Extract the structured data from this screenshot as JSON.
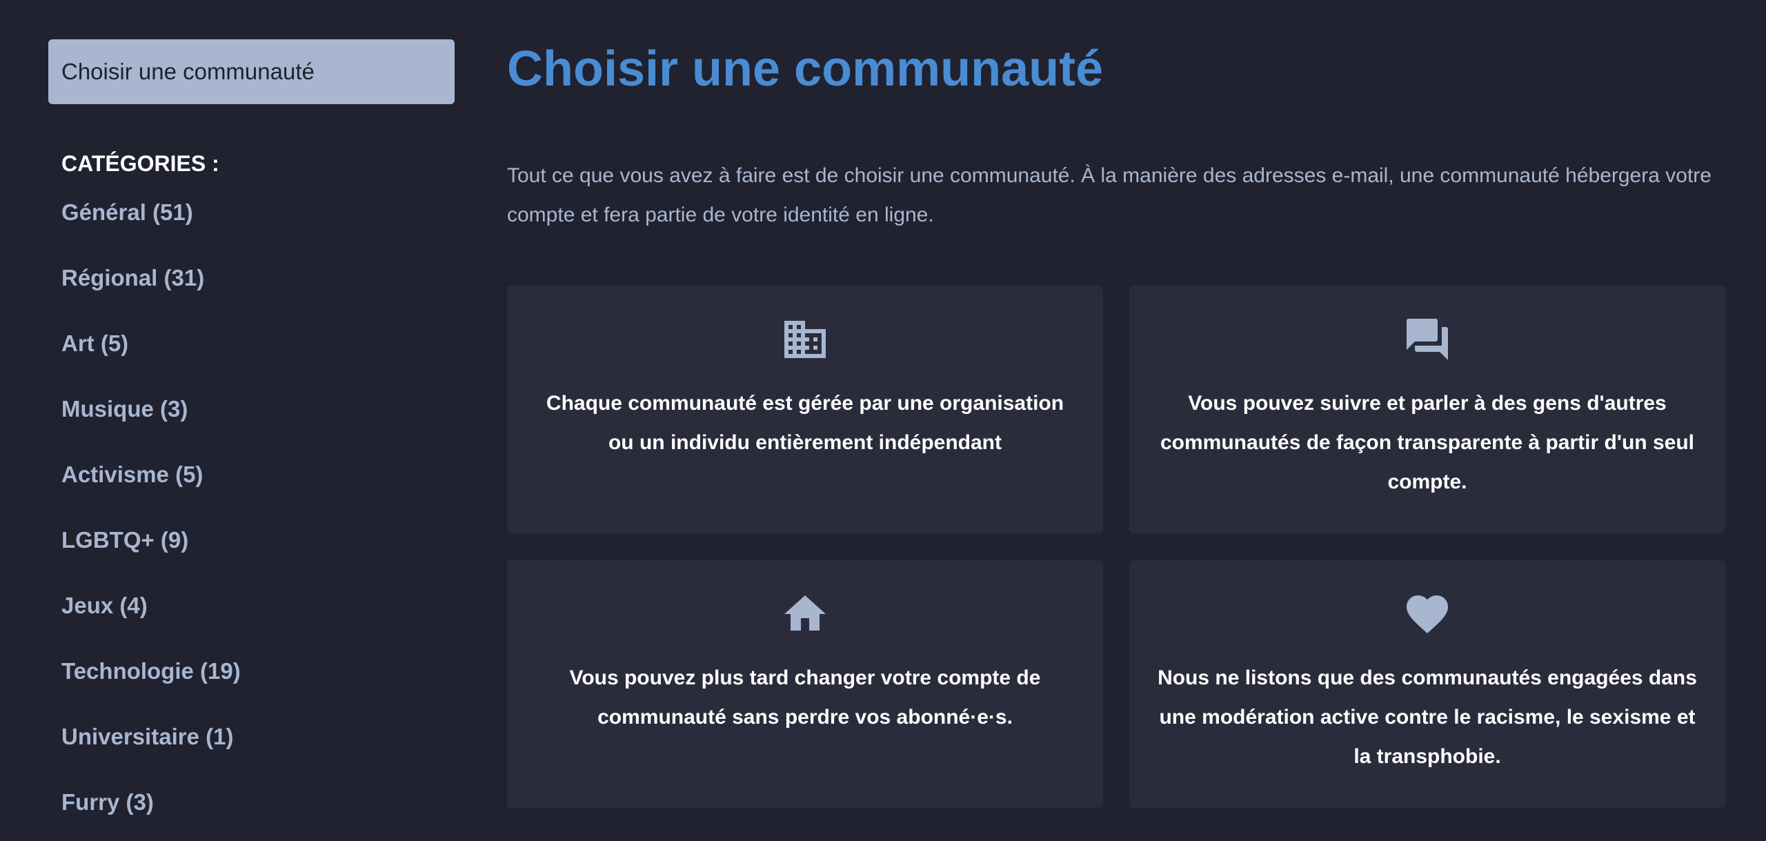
{
  "sidebar": {
    "active_label": "Choisir une communauté",
    "categories_heading": "CATÉGORIES :",
    "categories": [
      {
        "label": "Général (51)"
      },
      {
        "label": "Régional (31)"
      },
      {
        "label": "Art (5)"
      },
      {
        "label": "Musique (3)"
      },
      {
        "label": "Activisme (5)"
      },
      {
        "label": "LGBTQ+ (9)"
      },
      {
        "label": "Jeux (4)"
      },
      {
        "label": "Technologie (19)"
      },
      {
        "label": "Universitaire (1)"
      },
      {
        "label": "Furry (3)"
      }
    ]
  },
  "main": {
    "title": "Choisir une communauté",
    "lead": "Tout ce que vous avez à faire est de choisir une communauté. À la manière des adresses e-mail, une communauté hébergera votre compte et fera partie de votre identité en ligne.",
    "cards": [
      {
        "icon": "building-icon",
        "text": "Chaque communauté est gérée par une organisation ou un individu entièrement indépendant"
      },
      {
        "icon": "chat-bubbles-icon",
        "text": "Vous pouvez suivre et parler à des gens d'autres communautés de façon transparente à partir d'un seul compte."
      },
      {
        "icon": "home-icon",
        "text": "Vous pouvez plus tard changer votre compte de communauté sans perdre vos abonné·e·s."
      },
      {
        "icon": "heart-icon",
        "text": "Nous ne listons que des communautés engagées dans une modération active contre le racisme, le sexisme et la transphobie."
      }
    ]
  },
  "colors": {
    "background": "#202230",
    "card_background": "#2a2c3c",
    "accent_blue": "#4a8cd4",
    "muted_text": "#a9b6cf",
    "active_item_bg": "#a9b6cf"
  }
}
